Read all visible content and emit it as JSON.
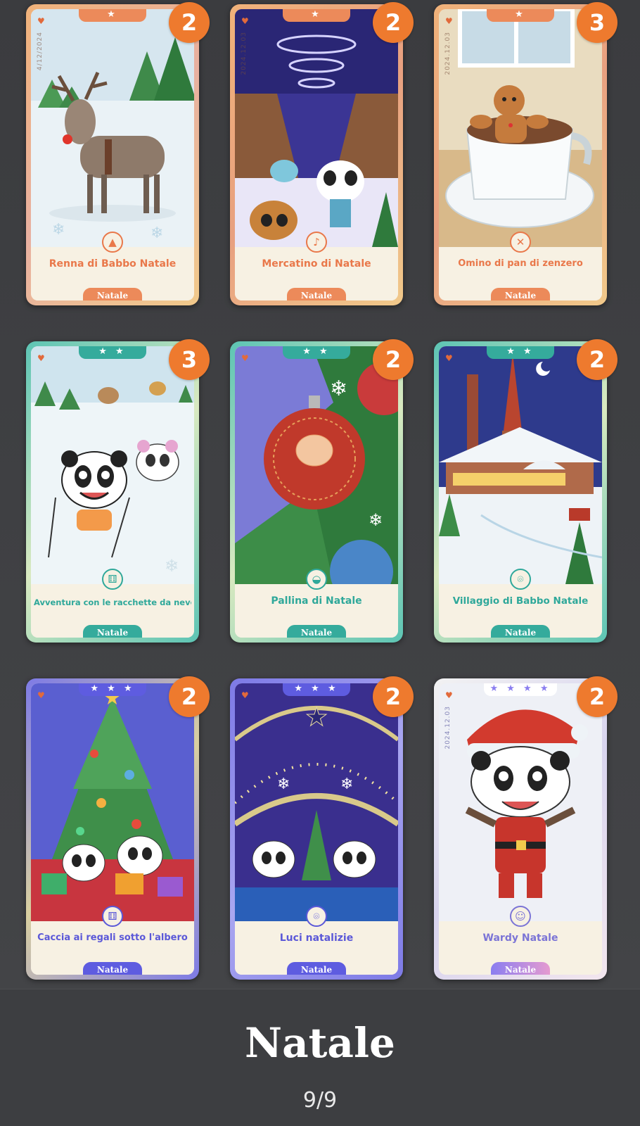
{
  "collection": {
    "title": "Natale",
    "page_counter": "9/9"
  },
  "cards": [
    {
      "title": "Renna di Babbo Natale",
      "tag": "Natale",
      "count": "2",
      "stars": "★",
      "date": "4/12/2024",
      "icon": "tree-icon",
      "accent": "#e9784a",
      "frame": "#e4a06a"
    },
    {
      "title": "Mercatino di Natale",
      "tag": "Natale",
      "count": "2",
      "stars": "★",
      "date": "2024.12.03",
      "icon": "music-note-icon",
      "accent": "#e9784a",
      "frame": "#e4a06a"
    },
    {
      "title": "Omino di pan di zenzero",
      "tag": "Natale",
      "count": "3",
      "stars": "★",
      "date": "2024.12.03",
      "icon": "cutlery-icon",
      "accent": "#e9784a",
      "frame": "#e4a06a"
    },
    {
      "title": "Avventura con le racchette da neve",
      "tag": "Natale",
      "count": "3",
      "stars": "★ ★",
      "date": "",
      "icon": "dice-icon",
      "accent": "#2fa89a",
      "frame": "#58c0b0"
    },
    {
      "title": "Pallina di Natale",
      "tag": "Natale",
      "count": "2",
      "stars": "★ ★",
      "date": "",
      "icon": "sled-icon",
      "accent": "#2fa89a",
      "frame": "#58c0b0"
    },
    {
      "title": "Villaggio di Babbo Natale",
      "tag": "Natale",
      "count": "2",
      "stars": "★ ★",
      "date": "",
      "icon": "location-pin-icon",
      "accent": "#2fa89a",
      "frame": "#58c0b0"
    },
    {
      "title": "Caccia ai regali sotto l'albero",
      "tag": "Natale",
      "count": "2",
      "stars": "★ ★ ★",
      "date": "",
      "icon": "dice-icon",
      "accent": "#5b58d8",
      "frame": "#7d7ae6"
    },
    {
      "title": "Luci natalizie",
      "tag": "Natale",
      "count": "2",
      "stars": "★ ★ ★",
      "date": "",
      "icon": "location-pin-icon",
      "accent": "#5b58d8",
      "frame": "#7d7ae6"
    },
    {
      "title": "Wardy Natale",
      "tag": "Natale",
      "count": "2",
      "stars": "★ ★ ★ ★",
      "date": "2024.12.03",
      "icon": "person-icon",
      "accent": "#7b74d6",
      "frame": "#d6d2ec"
    }
  ]
}
